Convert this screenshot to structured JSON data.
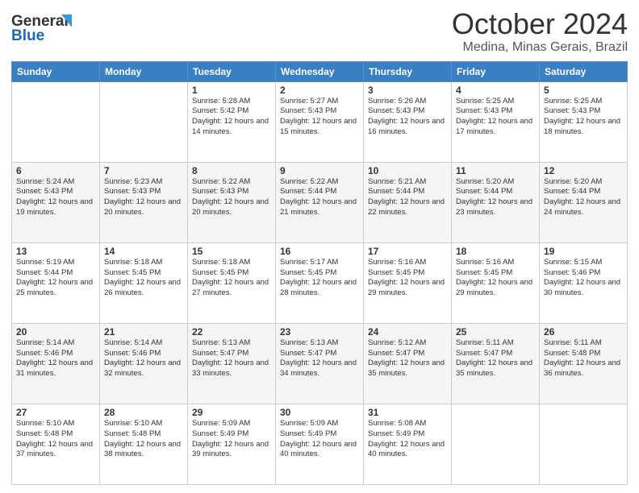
{
  "header": {
    "logo_text_general": "General",
    "logo_text_blue": "Blue",
    "month_title": "October 2024",
    "location": "Medina, Minas Gerais, Brazil"
  },
  "weekdays": [
    "Sunday",
    "Monday",
    "Tuesday",
    "Wednesday",
    "Thursday",
    "Friday",
    "Saturday"
  ],
  "weeks": [
    [
      {
        "day": "",
        "sunrise": "",
        "sunset": "",
        "daylight": ""
      },
      {
        "day": "",
        "sunrise": "",
        "sunset": "",
        "daylight": ""
      },
      {
        "day": "1",
        "sunrise": "Sunrise: 5:28 AM",
        "sunset": "Sunset: 5:42 PM",
        "daylight": "Daylight: 12 hours and 14 minutes."
      },
      {
        "day": "2",
        "sunrise": "Sunrise: 5:27 AM",
        "sunset": "Sunset: 5:43 PM",
        "daylight": "Daylight: 12 hours and 15 minutes."
      },
      {
        "day": "3",
        "sunrise": "Sunrise: 5:26 AM",
        "sunset": "Sunset: 5:43 PM",
        "daylight": "Daylight: 12 hours and 16 minutes."
      },
      {
        "day": "4",
        "sunrise": "Sunrise: 5:25 AM",
        "sunset": "Sunset: 5:43 PM",
        "daylight": "Daylight: 12 hours and 17 minutes."
      },
      {
        "day": "5",
        "sunrise": "Sunrise: 5:25 AM",
        "sunset": "Sunset: 5:43 PM",
        "daylight": "Daylight: 12 hours and 18 minutes."
      }
    ],
    [
      {
        "day": "6",
        "sunrise": "Sunrise: 5:24 AM",
        "sunset": "Sunset: 5:43 PM",
        "daylight": "Daylight: 12 hours and 19 minutes."
      },
      {
        "day": "7",
        "sunrise": "Sunrise: 5:23 AM",
        "sunset": "Sunset: 5:43 PM",
        "daylight": "Daylight: 12 hours and 20 minutes."
      },
      {
        "day": "8",
        "sunrise": "Sunrise: 5:22 AM",
        "sunset": "Sunset: 5:43 PM",
        "daylight": "Daylight: 12 hours and 20 minutes."
      },
      {
        "day": "9",
        "sunrise": "Sunrise: 5:22 AM",
        "sunset": "Sunset: 5:44 PM",
        "daylight": "Daylight: 12 hours and 21 minutes."
      },
      {
        "day": "10",
        "sunrise": "Sunrise: 5:21 AM",
        "sunset": "Sunset: 5:44 PM",
        "daylight": "Daylight: 12 hours and 22 minutes."
      },
      {
        "day": "11",
        "sunrise": "Sunrise: 5:20 AM",
        "sunset": "Sunset: 5:44 PM",
        "daylight": "Daylight: 12 hours and 23 minutes."
      },
      {
        "day": "12",
        "sunrise": "Sunrise: 5:20 AM",
        "sunset": "Sunset: 5:44 PM",
        "daylight": "Daylight: 12 hours and 24 minutes."
      }
    ],
    [
      {
        "day": "13",
        "sunrise": "Sunrise: 5:19 AM",
        "sunset": "Sunset: 5:44 PM",
        "daylight": "Daylight: 12 hours and 25 minutes."
      },
      {
        "day": "14",
        "sunrise": "Sunrise: 5:18 AM",
        "sunset": "Sunset: 5:45 PM",
        "daylight": "Daylight: 12 hours and 26 minutes."
      },
      {
        "day": "15",
        "sunrise": "Sunrise: 5:18 AM",
        "sunset": "Sunset: 5:45 PM",
        "daylight": "Daylight: 12 hours and 27 minutes."
      },
      {
        "day": "16",
        "sunrise": "Sunrise: 5:17 AM",
        "sunset": "Sunset: 5:45 PM",
        "daylight": "Daylight: 12 hours and 28 minutes."
      },
      {
        "day": "17",
        "sunrise": "Sunrise: 5:16 AM",
        "sunset": "Sunset: 5:45 PM",
        "daylight": "Daylight: 12 hours and 29 minutes."
      },
      {
        "day": "18",
        "sunrise": "Sunrise: 5:16 AM",
        "sunset": "Sunset: 5:45 PM",
        "daylight": "Daylight: 12 hours and 29 minutes."
      },
      {
        "day": "19",
        "sunrise": "Sunrise: 5:15 AM",
        "sunset": "Sunset: 5:46 PM",
        "daylight": "Daylight: 12 hours and 30 minutes."
      }
    ],
    [
      {
        "day": "20",
        "sunrise": "Sunrise: 5:14 AM",
        "sunset": "Sunset: 5:46 PM",
        "daylight": "Daylight: 12 hours and 31 minutes."
      },
      {
        "day": "21",
        "sunrise": "Sunrise: 5:14 AM",
        "sunset": "Sunset: 5:46 PM",
        "daylight": "Daylight: 12 hours and 32 minutes."
      },
      {
        "day": "22",
        "sunrise": "Sunrise: 5:13 AM",
        "sunset": "Sunset: 5:47 PM",
        "daylight": "Daylight: 12 hours and 33 minutes."
      },
      {
        "day": "23",
        "sunrise": "Sunrise: 5:13 AM",
        "sunset": "Sunset: 5:47 PM",
        "daylight": "Daylight: 12 hours and 34 minutes."
      },
      {
        "day": "24",
        "sunrise": "Sunrise: 5:12 AM",
        "sunset": "Sunset: 5:47 PM",
        "daylight": "Daylight: 12 hours and 35 minutes."
      },
      {
        "day": "25",
        "sunrise": "Sunrise: 5:11 AM",
        "sunset": "Sunset: 5:47 PM",
        "daylight": "Daylight: 12 hours and 35 minutes."
      },
      {
        "day": "26",
        "sunrise": "Sunrise: 5:11 AM",
        "sunset": "Sunset: 5:48 PM",
        "daylight": "Daylight: 12 hours and 36 minutes."
      }
    ],
    [
      {
        "day": "27",
        "sunrise": "Sunrise: 5:10 AM",
        "sunset": "Sunset: 5:48 PM",
        "daylight": "Daylight: 12 hours and 37 minutes."
      },
      {
        "day": "28",
        "sunrise": "Sunrise: 5:10 AM",
        "sunset": "Sunset: 5:48 PM",
        "daylight": "Daylight: 12 hours and 38 minutes."
      },
      {
        "day": "29",
        "sunrise": "Sunrise: 5:09 AM",
        "sunset": "Sunset: 5:49 PM",
        "daylight": "Daylight: 12 hours and 39 minutes."
      },
      {
        "day": "30",
        "sunrise": "Sunrise: 5:09 AM",
        "sunset": "Sunset: 5:49 PM",
        "daylight": "Daylight: 12 hours and 40 minutes."
      },
      {
        "day": "31",
        "sunrise": "Sunrise: 5:08 AM",
        "sunset": "Sunset: 5:49 PM",
        "daylight": "Daylight: 12 hours and 40 minutes."
      },
      {
        "day": "",
        "sunrise": "",
        "sunset": "",
        "daylight": ""
      },
      {
        "day": "",
        "sunrise": "",
        "sunset": "",
        "daylight": ""
      }
    ]
  ]
}
